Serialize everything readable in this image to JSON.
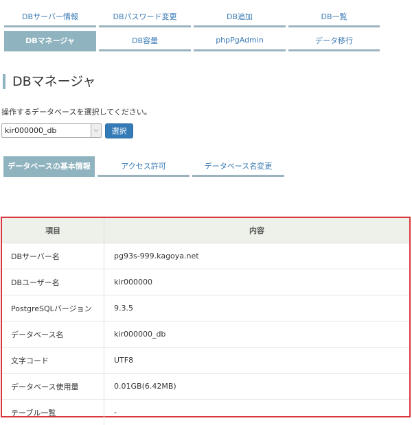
{
  "nav": {
    "row1": [
      "DBサーバー情報",
      "DBパスワード変更",
      "DB追加",
      "DB一覧"
    ],
    "row2": [
      "DBマネージャ",
      "DB容量",
      "phpPgAdmin",
      "データ移行"
    ]
  },
  "page_title": "DBマネージャ",
  "instruction": "操作するデータベースを選択してください。",
  "db_select": {
    "value": "kir000000_db",
    "arrow": "⌵"
  },
  "select_button": "選択",
  "subtabs": [
    "データベースの基本情報",
    "アクセス許可",
    "データベース名変更"
  ],
  "table": {
    "headers": [
      "項目",
      "内容"
    ],
    "rows": [
      [
        "DBサーバー名",
        "pg93s-999.kagoya.net"
      ],
      [
        "DBユーザー名",
        "kir000000"
      ],
      [
        "PostgreSQLバージョン",
        "9.3.5"
      ],
      [
        "データベース名",
        "kir000000_db"
      ],
      [
        "文字コード",
        "UTF8"
      ],
      [
        "データベース使用量",
        "0.01GB(6.42MB)"
      ],
      [
        "テーブル一覧",
        "-"
      ]
    ]
  },
  "colors": {
    "accent": "#8fb3bf",
    "link": "#3a7ab4",
    "button": "#337ab7",
    "highlight_border": "#d9363e"
  }
}
